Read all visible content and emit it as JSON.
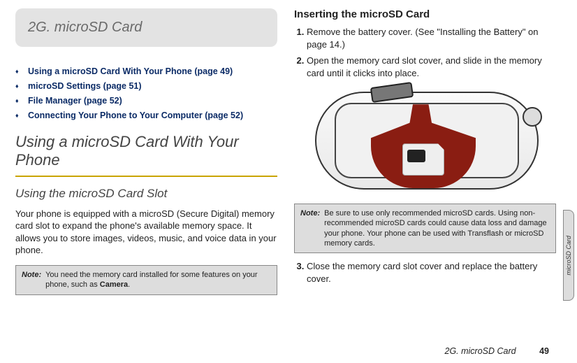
{
  "chapter": {
    "label": "2G. microSD Card"
  },
  "toc": {
    "items": [
      "Using a microSD Card With Your Phone (page 49)",
      "microSD Settings (page 51)",
      "File Manager (page 52)",
      "Connecting Your Phone to Your Computer (page 52)"
    ]
  },
  "section_heading": "Using a microSD Card With Your Phone",
  "subsection_heading": "Using the microSD Card Slot",
  "body_paragraph": "Your phone is equipped with a microSD (Secure Digital) memory card slot to expand the phone's available memory space. It allows you to store images, videos, music, and voice data in your phone.",
  "note1": {
    "label": "Note:",
    "text_before": "You need the memory card installed for some features on your phone, such as ",
    "bold": "Camera",
    "text_after": "."
  },
  "right": {
    "heading": "Inserting the microSD Card",
    "step1": "Remove the battery cover. (See \"Installing the Battery\" on page 14.)",
    "step2": "Open the memory card slot cover, and slide in the memory card until it clicks into place.",
    "step3": "Close the memory card slot cover and replace the battery cover."
  },
  "note2": {
    "label": "Note:",
    "text": "Be sure to use only recommended microSD cards. Using non-recommended microSD cards could cause data loss and damage your phone. Your phone can be used with Transflash or microSD memory cards."
  },
  "side_tab": "microSD Card",
  "footer": {
    "chapter": "2G. microSD Card",
    "page": "49"
  }
}
